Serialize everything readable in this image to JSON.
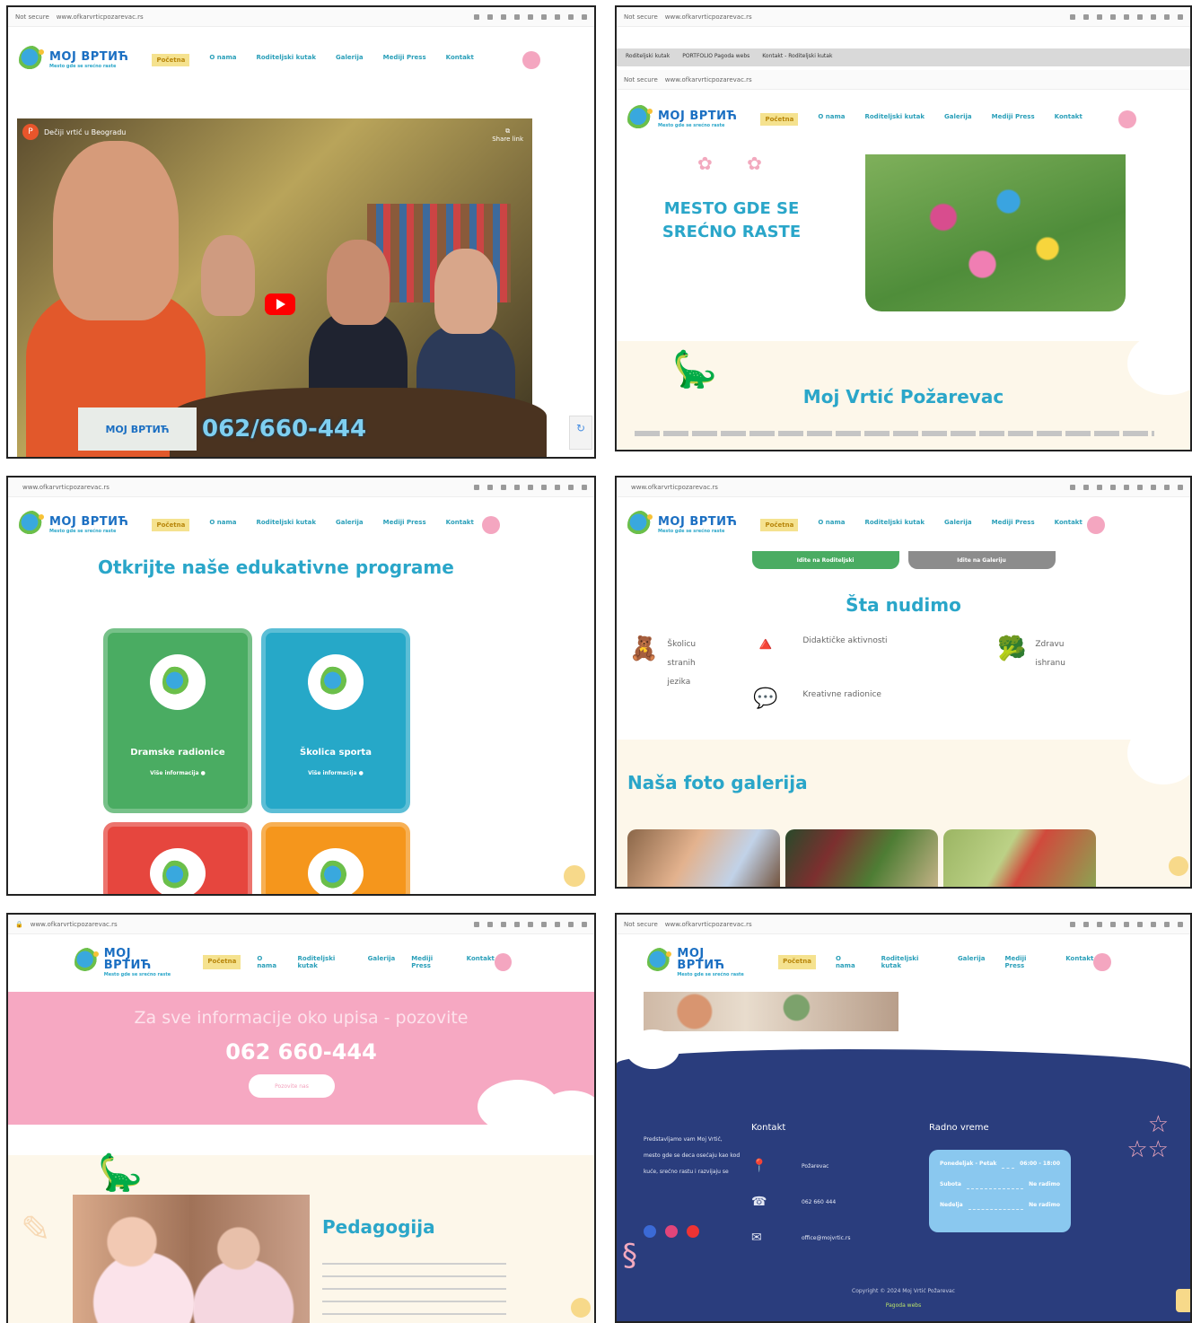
{
  "site": {
    "logo_text": "МОЈ ВРТИЋ",
    "logo_sub": "Mesto gde se srećno raste",
    "url": "www.ofkarvrticpozarevac.rs",
    "url_prefix": "Not secure",
    "nav": [
      "Početna",
      "O nama",
      "Roditeljski kutak",
      "Galerija",
      "Mediji Press",
      "Kontakt"
    ]
  },
  "screen1": {
    "video_title": "Dečiji vrtić u Beogradu",
    "channel_initial": "P",
    "share_label": "Share link",
    "overlay_logo": "МОЈ ВРТИЋ",
    "phone": "062/660-444"
  },
  "screen2": {
    "tabs": [
      "Roditeljski kutak",
      "PORTFOLIO Pagoda webs",
      "Kontakt - Roditeljski kutak"
    ],
    "flowers": "✿ ✿",
    "hero_title": "MESTO GDE SE SREĆNO RASTE",
    "band_title": "Moj Vrtić Požarevac"
  },
  "screen3": {
    "title": "Otkrijte naše edukativne programe",
    "cards": [
      {
        "title": "Dramske radionice",
        "more": "Više informacija ●",
        "color": "#4aac62"
      },
      {
        "title": "Školica sporta",
        "more": "Više informacija ●",
        "color": "#26a8c8"
      },
      {
        "title": "",
        "more": "",
        "color": "#e6463e"
      },
      {
        "title": "",
        "more": "",
        "color": "#f5961c"
      }
    ]
  },
  "screen4": {
    "pager": [
      "Idite na Roditeljski",
      "Idite na Galeriju"
    ],
    "title": "Šta nudimo",
    "offers": [
      {
        "icon": "teddy-bear-icon",
        "glyph": "🧸",
        "label": "Školicu stranih jezika"
      },
      {
        "icon": "pyramid-icon",
        "glyph": "🔺",
        "label": "Didaktičke aktivnosti"
      },
      {
        "icon": "speech-bubble-icon",
        "glyph": "💬",
        "label": "Kreativne radionice"
      },
      {
        "icon": "healthy-food-icon",
        "glyph": "🥦",
        "label": "Zdravu ishranu"
      }
    ],
    "gallery_title": "Naša foto galerija"
  },
  "screen5": {
    "question": "Za sve informacije oko upisa - pozovite",
    "phone": "062 660-444",
    "button": "Pozovite nas",
    "heading": "Pedagogija"
  },
  "screen6": {
    "about": "Predstavljamo vam Moj Vrtić, mesto gde se deca osećaju kao kod kuće, srećno rastu i razvijaju se",
    "contact_heading": "Kontakt",
    "contact": [
      {
        "icon": "location-pin-icon",
        "glyph": "📍",
        "text": "Požarevac"
      },
      {
        "icon": "phone-icon",
        "glyph": "☎",
        "text": "062 660 444"
      },
      {
        "icon": "email-icon",
        "glyph": "✉",
        "text": "office@mojvrtic.rs"
      }
    ],
    "hours_heading": "Radno vreme",
    "hours": [
      {
        "day": "Ponedeljak - Petak",
        "time": "06:00 - 18:00"
      },
      {
        "day": "Subota",
        "time": "Ne radimo"
      },
      {
        "day": "Nedelja",
        "time": "Ne radimo"
      }
    ],
    "copyright": "Copyright © 2024 Moj Vrtić Požarevac",
    "credit": "Pagoda webs"
  },
  "colors": {
    "accent": "#2aa6c9",
    "brand_blue": "#1b6fc2",
    "pink": "#f6a8c2",
    "navy": "#2a3d7d",
    "cream": "#fdf7ea"
  }
}
